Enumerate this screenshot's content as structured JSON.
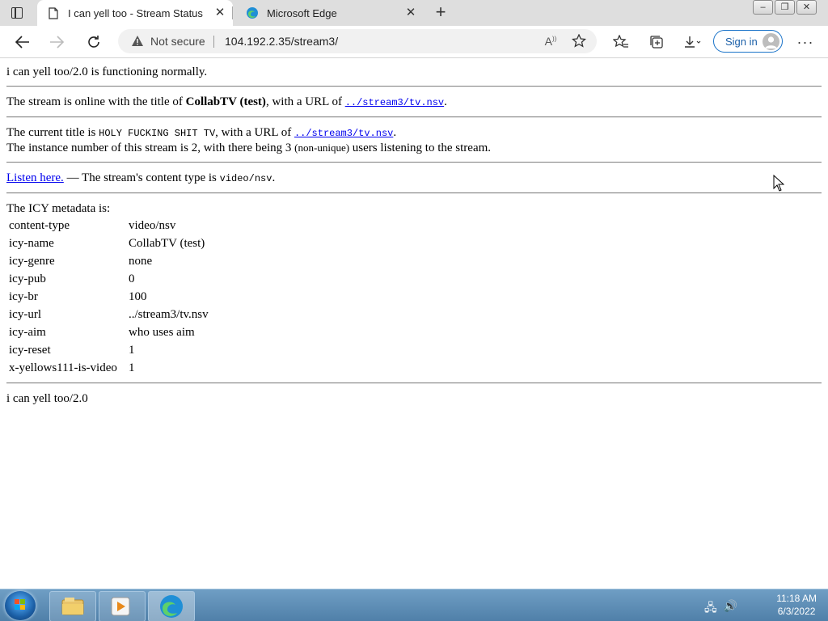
{
  "browser": {
    "tabs": [
      {
        "title": "I can yell too - Stream Status",
        "active": true
      },
      {
        "title": "Microsoft Edge",
        "active": false
      }
    ],
    "address": {
      "security_label": "Not secure",
      "url": "104.192.2.35/stream3/"
    },
    "sign_in_label": "Sign in",
    "accent_color": "#1a73c9"
  },
  "page": {
    "status_line": "i can yell too/2.0 is functioning normally.",
    "online": {
      "prefix": "The stream is online with the title of ",
      "title": "CollabTV (test)",
      "mid": ", with a URL of ",
      "url": "../stream3/tv.nsv",
      "suffix": "."
    },
    "current": {
      "prefix": "The current title is ",
      "title": "HOLY FUCKING SHIT TV",
      "mid": ", with a URL of ",
      "url": "../stream3/tv.nsv",
      "suffix": "."
    },
    "instance": {
      "prefix": "The instance number of this stream is 2, with there being 3 ",
      "note": "(non-unique)",
      "suffix": " users listening to the stream."
    },
    "listen": {
      "link": "Listen here.",
      "middle": " — The stream's content type is ",
      "type": "video/nsv",
      "suffix": "."
    },
    "icy_heading": "The ICY metadata is:",
    "metadata": [
      {
        "key": "content-type",
        "value": "video/nsv"
      },
      {
        "key": "icy-name",
        "value": "CollabTV (test)"
      },
      {
        "key": "icy-genre",
        "value": "none"
      },
      {
        "key": "icy-pub",
        "value": "0"
      },
      {
        "key": "icy-br",
        "value": "100"
      },
      {
        "key": "icy-url",
        "value": "../stream3/tv.nsv"
      },
      {
        "key": "icy-aim",
        "value": "who uses aim"
      },
      {
        "key": "icy-reset",
        "value": "1"
      },
      {
        "key": "x-yellows111-is-video",
        "value": "1"
      }
    ],
    "footer": "i can yell too/2.0"
  },
  "taskbar": {
    "time": "11:18 AM",
    "date": "6/3/2022",
    "apps": [
      "file-explorer-icon",
      "media-player-icon",
      "edge-icon"
    ]
  }
}
